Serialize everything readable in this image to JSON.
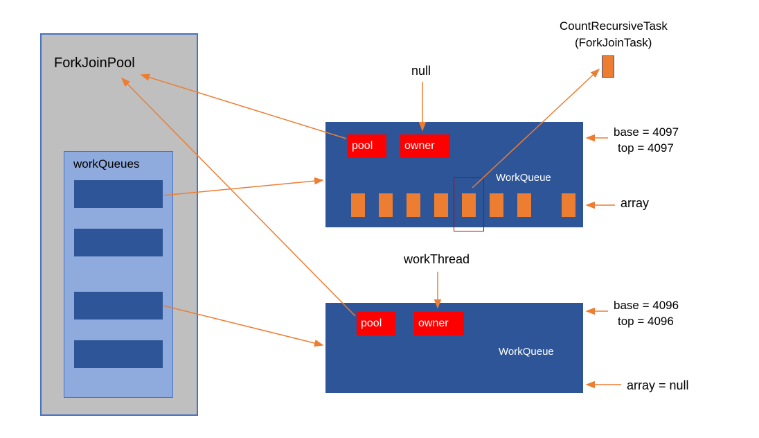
{
  "pool": {
    "title": "ForkJoinPool",
    "workQueuesLabel": "workQueues"
  },
  "labels": {
    "null": "null",
    "pool": "pool",
    "owner": "owner",
    "workQueue": "WorkQueue",
    "workThread": "workThread",
    "array": "array",
    "arrayNull": "array = null"
  },
  "task": {
    "line1": "CountRecursiveTask",
    "line2": "(ForkJoinTask)"
  },
  "wq1": {
    "base": "base = 4097",
    "top": "top = 4097"
  },
  "wq2": {
    "base": "base = 4096",
    "top": "top = 4096"
  },
  "colors": {
    "darkBlue": "#2e5597",
    "lightBlue": "#8faadc",
    "gray": "#bfbfbf",
    "orange": "#ed7d31",
    "red": "#ff0000",
    "darkRed": "#c00000"
  }
}
